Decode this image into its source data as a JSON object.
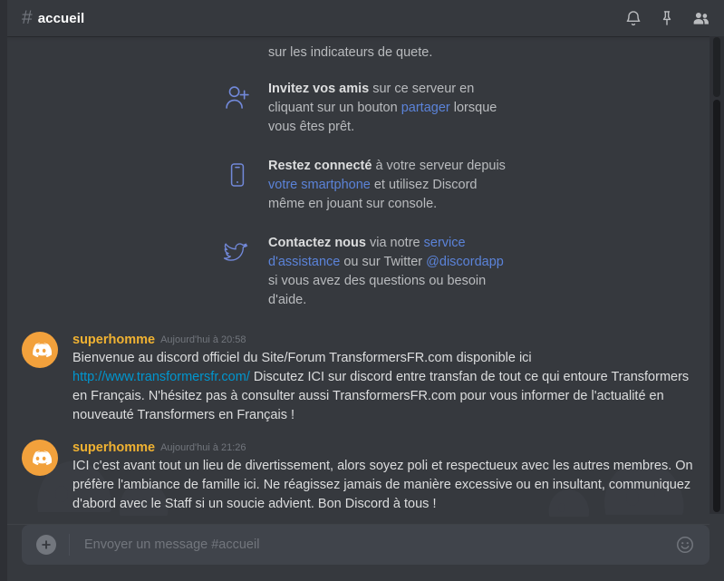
{
  "header": {
    "hash": "#",
    "channel_name": "accueil",
    "icons": [
      {
        "name": "bell-icon",
        "label": "Notifications"
      },
      {
        "name": "pin-icon",
        "label": "Messages épinglés"
      },
      {
        "name": "members-icon",
        "label": "Liste des membres"
      }
    ]
  },
  "welcome_tips": [
    {
      "icon": "quest-indicator-icon",
      "clipped": true,
      "segments": [
        {
          "text": "sur les indicateurs de quete.",
          "style": "normal"
        }
      ]
    },
    {
      "icon": "add-friend-icon",
      "clipped": false,
      "segments": [
        {
          "text": "Invitez vos amis",
          "style": "bold"
        },
        {
          "text": " sur ce serveur en cliquant sur un bouton ",
          "style": "normal"
        },
        {
          "text": "partager",
          "style": "link"
        },
        {
          "text": " lorsque vous êtes prêt.",
          "style": "normal"
        }
      ]
    },
    {
      "icon": "mobile-phone-icon",
      "clipped": false,
      "segments": [
        {
          "text": "Restez connecté",
          "style": "bold"
        },
        {
          "text": " à votre serveur depuis ",
          "style": "normal"
        },
        {
          "text": "votre smartphone",
          "style": "link"
        },
        {
          "text": " et utilisez Discord même en jouant sur console.",
          "style": "normal"
        }
      ]
    },
    {
      "icon": "twitter-bird-icon",
      "clipped": false,
      "segments": [
        {
          "text": "Contactez nous",
          "style": "bold"
        },
        {
          "text": " via notre ",
          "style": "normal"
        },
        {
          "text": "service d'assistance",
          "style": "link"
        },
        {
          "text": " ou sur Twitter ",
          "style": "normal"
        },
        {
          "text": "@discordapp",
          "style": "link"
        },
        {
          "text": " si vous avez des questions ou besoin d'aide.",
          "style": "normal"
        }
      ]
    }
  ],
  "messages": [
    {
      "avatar": "discord-logo-avatar",
      "author": "superhomme",
      "timestamp": "Aujourd'hui à 20:58",
      "segments": [
        {
          "text": "Bienvenue au discord officiel du Site/Forum TransformersFR.com disponible ici ",
          "style": "normal"
        },
        {
          "text": "http://www.transformersfr.com/",
          "style": "link"
        },
        {
          "text": " Discutez ICI sur discord entre transfan de tout ce qui entoure Transformers en Français. N'hésitez pas à consulter aussi TransformersFR.com pour vous informer de l'actualité en nouveauté Transformers en Français !",
          "style": "normal"
        }
      ]
    },
    {
      "avatar": "discord-logo-avatar",
      "author": "superhomme",
      "timestamp": "Aujourd'hui à 21:26",
      "segments": [
        {
          "text": "ICI c'est avant tout un lieu de divertissement, alors soyez poli et respectueux avec les autres membres. On préfère l'ambiance de famille ici. Ne réagissez jamais de manière excessive ou en insultant, communiquez d'abord avec le Staff si un soucie advient. Bon Discord à tous !",
          "style": "normal"
        }
      ]
    }
  ],
  "composer": {
    "add_button": "add-attachment-button",
    "placeholder": "Envoyer un message #accueil",
    "value": "",
    "emoji_button": "emoji-picker-button"
  },
  "colors": {
    "app_bg": "#36393e",
    "rail_bg": "#2e3035",
    "composer_bg": "#40444b",
    "author": "#f0b232",
    "link": "#0096cf",
    "tip_link": "#5b83d9",
    "avatar_bg": "#f2a13c",
    "text": "#dcddde",
    "muted": "#72767d"
  }
}
